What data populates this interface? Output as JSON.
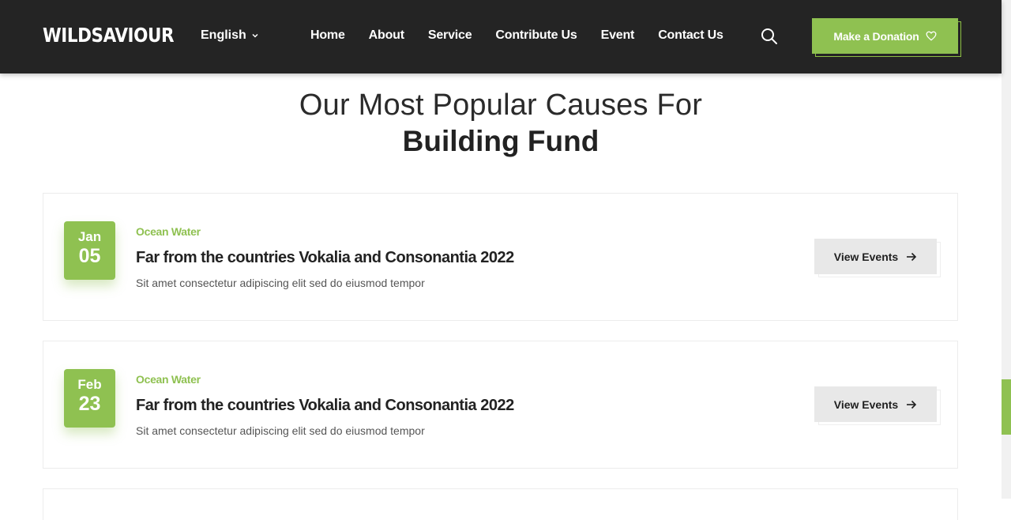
{
  "header": {
    "logo": "WILDSAVIOUR",
    "language": "English",
    "nav": [
      "Home",
      "About",
      "Service",
      "Contribute Us",
      "Event",
      "Contact Us"
    ],
    "donate_label": "Make a Donation"
  },
  "section": {
    "title_line1": "Our Most Popular Causes For",
    "title_line2": "Building Fund"
  },
  "events": [
    {
      "month": "Jan",
      "day": "05",
      "category": "Ocean Water",
      "title": "Far from the countries Vokalia and Consonantia 2022",
      "description": "Sit amet consectetur adipiscing elit sed do eiusmod tempor",
      "button": "View Events"
    },
    {
      "month": "Feb",
      "day": "23",
      "category": "Ocean Water",
      "title": "Far from the countries Vokalia and Consonantia 2022",
      "description": "Sit amet consectetur adipiscing elit sed do eiusmod tempor",
      "button": "View Events"
    }
  ],
  "colors": {
    "accent": "#8fc151",
    "header_bg": "#242424",
    "view_button_bg": "#e8e8e8"
  },
  "icons": {
    "language_dropdown": "chevron-down-icon",
    "search": "search-icon",
    "donate": "heart-icon",
    "view_events": "arrow-right-icon"
  }
}
